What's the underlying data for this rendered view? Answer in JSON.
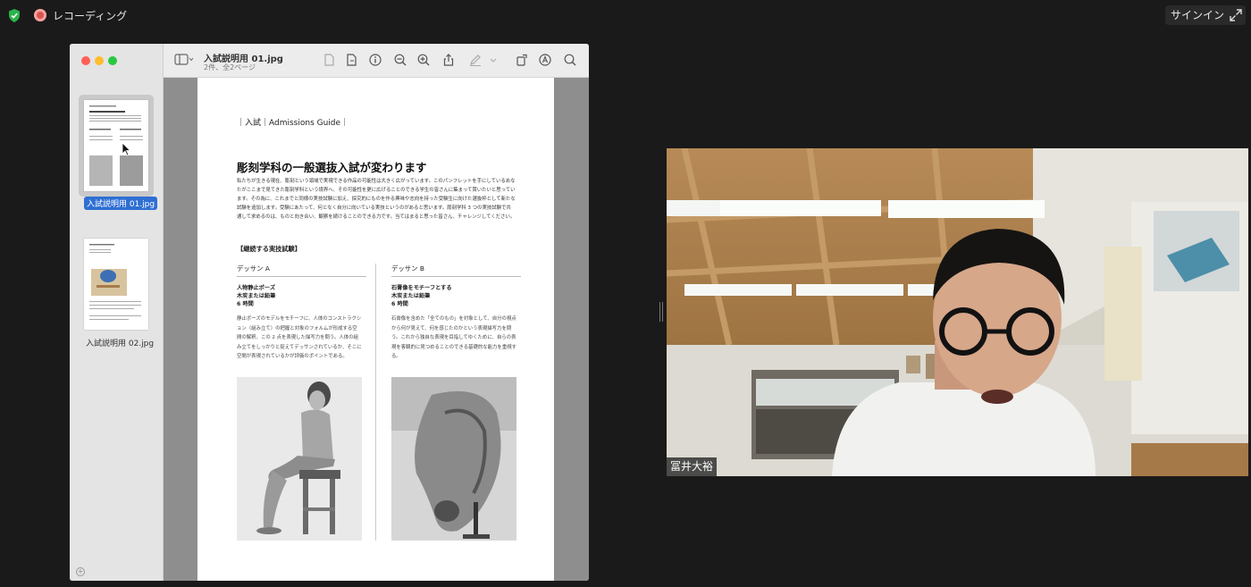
{
  "topbar": {
    "recording_label": "レコーディング",
    "signin_label": "サインイン"
  },
  "preview": {
    "doc_title": "入試説明用 01.jpg",
    "doc_subtitle": "2件、全2ページ",
    "thumbnails": [
      {
        "label": "入試説明用 01.jpg",
        "selected": true
      },
      {
        "label": "入試説明用 02.jpg",
        "selected": false
      }
    ],
    "page": {
      "guide": "｜入試｜Admissions Guide｜",
      "title": "彫刻学科の一般選抜入試が変わります",
      "intro": "私たちが生きる現在、彫刻という領域で実現できる作品の可能性は大きく広がっています。このパンフレットを手にしているあなたがここまで見てきた彫刻学科という境界へ、その可能性を更に広げることのできる学生の皆さんに集まって貰いたいと思っています。その為に、これまでと同様の実技試験に加え、探究的にものを作る興味や志向を持った受験生に向けた選抜枠として新たな試験を追加します。受験にあたって、何となく自分に向いている実技というのがあると思います。彫刻学科 3 つの実技試験で共通して求めるのは、ものと向き合い、観察を続けることのできる力です。当てはまると思った皆さん、チャレンジしてください。",
      "section": "【継続する実技試験】",
      "columns": [
        {
          "heading": "デッサン A",
          "theme": [
            "人物静止ポーズ",
            "木炭または鉛筆",
            "6 時間"
          ],
          "body": "静止ポーズのモデルをモチーフに、人体のコンストラクション（組み立て）の把握と対象のフォルムが形成する空間の解釈、この 2 点を表現した描写力を問う。人体の組み立てをしっかりと捉えてデッサンされているか、そこに空間が表現されているかが評価のポイントである。"
        },
        {
          "heading": "デッサン B",
          "theme": [
            "石膏像をモチーフとする",
            "木炭または鉛筆",
            "6 時間"
          ],
          "body": "石膏像を含めた「全てのもの」を対象として、自分の視点から何が見えて、何を感じたのかという表現描写力を問う。これから独自な表現を目指してゆくために、自らの表現を客観的に見つめることのできる基礎的な能力を重視する。"
        }
      ]
    }
  },
  "video": {
    "participant_name": "冨井大裕"
  },
  "colors": {
    "accent": "#2f6fd3",
    "recording": "#d9534f",
    "traffic_red": "#ff5f57",
    "traffic_yellow": "#febc2e",
    "traffic_green": "#28c840"
  }
}
